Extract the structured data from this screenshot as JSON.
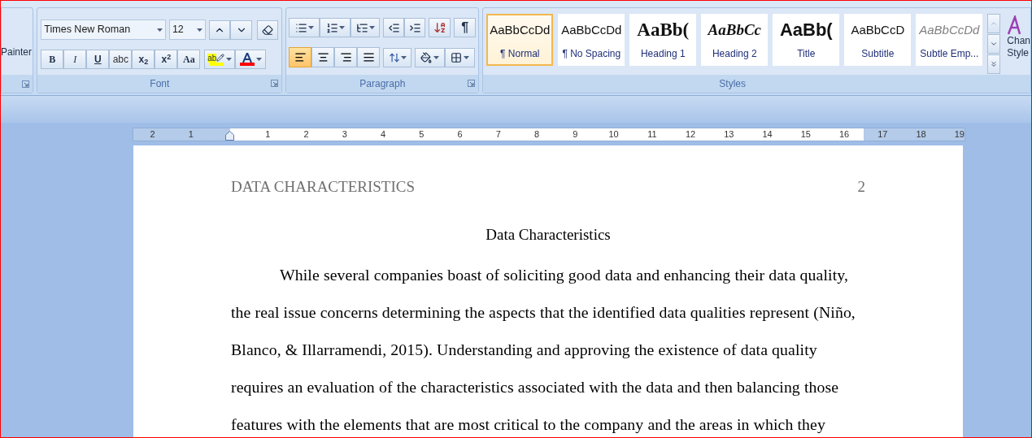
{
  "ribbon": {
    "clipboard": {
      "partial_label": "Painter"
    },
    "font": {
      "label": "Font",
      "font_name": "Times New Roman",
      "font_size": "12",
      "format_buttons": [
        {
          "kind": "bold",
          "text": "B"
        },
        {
          "kind": "italic",
          "text": "I"
        },
        {
          "kind": "underline",
          "text": "U"
        },
        {
          "kind": "strike",
          "text": "abc"
        },
        {
          "kind": "sub",
          "text": "x$_{2}$"
        },
        {
          "kind": "sup",
          "text": "x$^{2}$"
        },
        {
          "kind": "case",
          "text": "Aa"
        }
      ],
      "highlight_text": "ab"
    },
    "paragraph": {
      "label": "Paragraph",
      "pilcrow": "¶",
      "alignment": [
        {
          "kind": "left",
          "selected": true
        },
        {
          "kind": "center",
          "selected": false
        },
        {
          "kind": "right",
          "selected": false
        },
        {
          "kind": "justify",
          "selected": false
        }
      ]
    },
    "styles": {
      "label": "Styles",
      "items": [
        {
          "kind": "normal",
          "sample": "AaBbCcDd",
          "label": "¶ Normal",
          "selected": true
        },
        {
          "kind": "normal",
          "sample": "AaBbCcDd",
          "label": "¶ No Spacing",
          "selected": false
        },
        {
          "kind": "heading1",
          "sample": "AaBb(",
          "label": "Heading 1",
          "selected": false
        },
        {
          "kind": "heading2",
          "sample": "AaBbCc",
          "label": "Heading 2",
          "selected": false
        },
        {
          "kind": "title",
          "sample": "AaBb(",
          "label": "Title",
          "selected": false
        },
        {
          "kind": "subtitle",
          "sample": "AaBbCcD",
          "label": "Subtitle",
          "selected": false
        },
        {
          "kind": "subtle",
          "sample": "AaBbCcDd",
          "label": "Subtle Emp...",
          "selected": false
        }
      ],
      "change_styles": [
        "Chan",
        "Style"
      ]
    }
  },
  "ruler": {
    "left_numbers": [
      "2",
      "1"
    ],
    "numbers": [
      "1",
      "2",
      "3",
      "4",
      "5",
      "6",
      "7",
      "8",
      "9",
      "10",
      "11",
      "12",
      "13",
      "14",
      "15",
      "16",
      "17",
      "18",
      "19"
    ]
  },
  "document": {
    "header": "DATA CHARACTERISTICS",
    "page_number": "2",
    "title": "Data Characteristics",
    "paragraph": "While several companies boast of soliciting good data and enhancing their data quality, the real issue concerns determining the aspects that the identified data qualities represent (Niño, Blanco, & Illarramendi, 2015). Understanding and approving the existence of data quality requires an evaluation of the characteristics associated with the data and then balancing those features with the elements that are most critical to the company and the areas in which they"
  }
}
